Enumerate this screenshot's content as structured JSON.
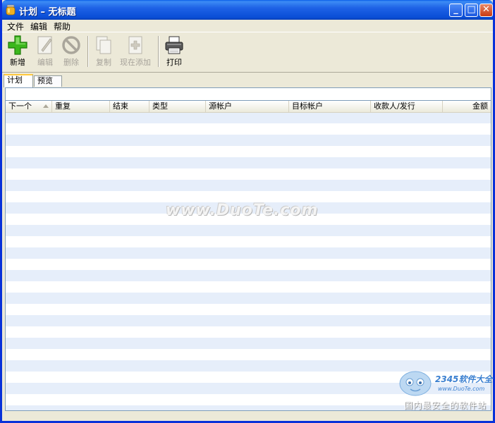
{
  "window": {
    "title": "计划 – 无标题",
    "controls": {
      "minimize": "_",
      "maximize": "□",
      "close": "✕"
    }
  },
  "menu": {
    "items": [
      "文件",
      "编辑",
      "帮助"
    ]
  },
  "toolbar": {
    "items": [
      {
        "label": "新增",
        "icon": "add-icon",
        "enabled": true
      },
      {
        "label": "编辑",
        "icon": "edit-icon",
        "enabled": false
      },
      {
        "label": "删除",
        "icon": "delete-icon",
        "enabled": false
      },
      {
        "label": "复制",
        "icon": "copy-icon",
        "enabled": false
      },
      {
        "label": "现在添加",
        "icon": "add-now-icon",
        "enabled": false
      },
      {
        "label": "打印",
        "icon": "print-icon",
        "enabled": true
      }
    ]
  },
  "tabs": [
    {
      "label": "计划",
      "active": true
    },
    {
      "label": "预览",
      "active": false
    }
  ],
  "grid": {
    "columns": [
      "下一个",
      "重复",
      "结束",
      "类型",
      "源帐户",
      "目标帐户",
      "收款人/发行",
      "金额"
    ],
    "rows": []
  },
  "watermark": {
    "text": "www.DuoTe.com",
    "logo_brand": "2345软件大全",
    "logo_url": "www.DuoTe.com",
    "logo_slogan": "国内最安全的软件站"
  },
  "colors": {
    "titlebar": "#0a4ed6",
    "row_alt": "#e6eefa",
    "add_green": "#3cb71c"
  }
}
